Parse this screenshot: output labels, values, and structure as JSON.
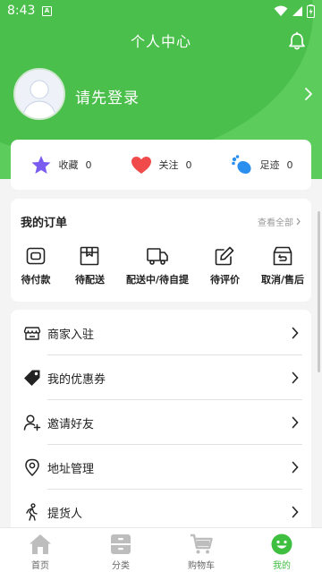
{
  "status_bar": {
    "time": "8:43",
    "notification_icon": "A"
  },
  "header": {
    "title": "个人中心",
    "login_prompt": "请先登录",
    "bell_icon": "bell-icon"
  },
  "stats": [
    {
      "label": "收藏",
      "count": "0",
      "icon": "star-icon"
    },
    {
      "label": "关注",
      "count": "0",
      "icon": "heart-icon"
    },
    {
      "label": "足迹",
      "count": "0",
      "icon": "footprint-icon"
    }
  ],
  "orders": {
    "title": "我的订单",
    "view_all": "查看全部",
    "items": [
      {
        "label": "待付款",
        "icon": "wallet-icon"
      },
      {
        "label": "待配送",
        "icon": "box-icon"
      },
      {
        "label": "配送中/待自提",
        "icon": "truck-icon"
      },
      {
        "label": "待评价",
        "icon": "edit-icon"
      },
      {
        "label": "取消/售后",
        "icon": "return-box-icon"
      }
    ]
  },
  "menu": [
    {
      "label": "商家入驻",
      "icon": "store-icon"
    },
    {
      "label": "我的优惠券",
      "icon": "coupon-tag-icon"
    },
    {
      "label": "邀请好友",
      "icon": "add-user-icon"
    },
    {
      "label": "地址管理",
      "icon": "location-pin-icon"
    },
    {
      "label": "提货人",
      "icon": "walking-person-icon"
    }
  ],
  "tabbar": [
    {
      "label": "首页",
      "icon": "home-icon",
      "active": false
    },
    {
      "label": "分类",
      "icon": "category-icon",
      "active": false
    },
    {
      "label": "购物车",
      "icon": "cart-icon",
      "active": false
    },
    {
      "label": "我的",
      "icon": "smiley-icon",
      "active": true
    }
  ],
  "colors": {
    "brand_green": "#5ccd5c",
    "active_tab": "#3fbf3f",
    "star": "#7b5cf0",
    "heart": "#f04a4a",
    "footprint": "#2b8ff0"
  }
}
